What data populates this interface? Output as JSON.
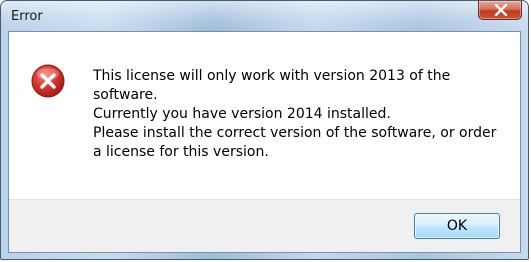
{
  "window": {
    "title": "Error"
  },
  "dialog": {
    "icon": "error-icon",
    "message_lines": [
      "This license will only work with version 2013 of the",
      "software.",
      "Currently you have version 2014 installed.",
      "Please install the correct version of the software, or order",
      "a license for this version."
    ]
  },
  "buttons": {
    "close_icon": "close-icon",
    "ok_label": "OK"
  },
  "colors": {
    "close_button_red": "#c03a22",
    "error_icon_red": "#c9302c",
    "ok_button_border": "#3c7fb1"
  }
}
